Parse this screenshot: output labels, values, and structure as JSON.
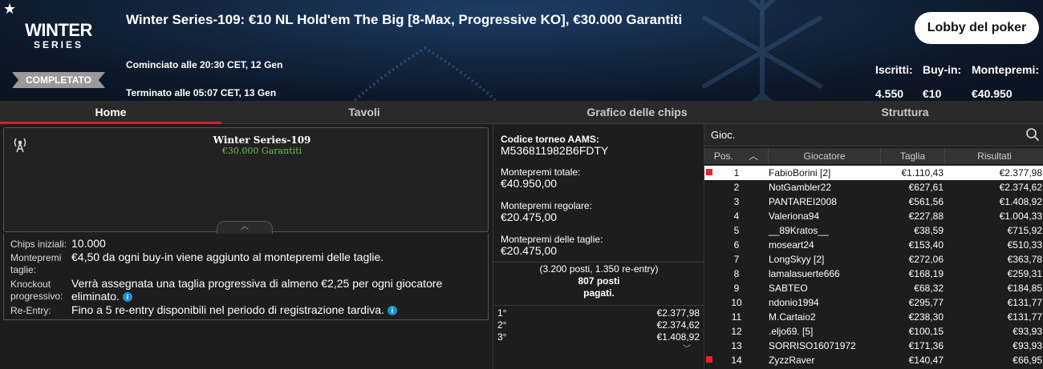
{
  "header": {
    "logo_line1": "WINTER",
    "logo_line2": "SERIES",
    "status_badge": "COMPLETATO",
    "title": "Winter Series-109: €10 NL Hold'em The Big [8-Max, Progressive KO], €30.000 Garantiti",
    "started": "Cominciato alle 20:30 CET, 12 Gen",
    "ended": "Terminato alle 05:07 CET, 13 Gen",
    "lobby_button": "Lobby del poker",
    "stats": [
      {
        "label": "Iscritti:",
        "value": "4.550"
      },
      {
        "label": "Buy-in:",
        "value": "€10"
      },
      {
        "label": "Montepremi:",
        "value": "€40.950"
      }
    ]
  },
  "tabs": [
    {
      "label": "Home",
      "active": true
    },
    {
      "label": "Tavoli",
      "active": false
    },
    {
      "label": "Grafico delle chips",
      "active": false
    },
    {
      "label": "Struttura",
      "active": false
    }
  ],
  "tournament_box": {
    "name": "Winter Series-109",
    "guarantee": "€30.000 Garantiti",
    "guarantee_color": "#6bbf4e"
  },
  "info": {
    "chips_label": "Chips iniziali:",
    "chips_value": "10.000",
    "bounty_pool_label_1": "Montepremi",
    "bounty_pool_label_2": "taglie:",
    "bounty_pool_value": "€4,50 da ogni buy-in viene aggiunto al montepremi delle taglie.",
    "knockout_label_1": "Knockout",
    "knockout_label_2": "progressivo:",
    "knockout_value_1": "Verrà assegnata una taglia progressiva di almeno €2,25 per ogni giocatore",
    "knockout_value_2": "eliminato.",
    "reentry_label": "Re-Entry:",
    "reentry_value": "Fino a 5 re-entry disponibili nel periodo di registrazione tardiva."
  },
  "middle": {
    "aams_label": "Codice torneo AAMS:",
    "aams_code": "M536811982B6FDTY",
    "total_label": "Montepremi totale:",
    "total_value": "€40.950,00",
    "regular_label": "Montepremi regolare:",
    "regular_value": "€20.475,00",
    "bounty_label": "Montepremi delle taglie:",
    "bounty_value": "€20.475,00",
    "seats_line1": "(3.200 posti, 1.350 re-entry)",
    "seats_line2": "807 posti",
    "seats_line3": "pagati.",
    "prizes": [
      {
        "place": "1°",
        "amount": "€2.377,98"
      },
      {
        "place": "2°",
        "amount": "€2.374,62"
      },
      {
        "place": "3°",
        "amount": "€1.408,92"
      }
    ]
  },
  "players": {
    "search_label": "Gioc.",
    "columns": [
      "Pos.",
      "Giocatore",
      "Taglia",
      "Risultati"
    ],
    "rows": [
      {
        "pos": "1",
        "name": "FabioBorini [2]",
        "stack": "€1.110,43",
        "result": "€2.377,98",
        "highlight": true,
        "mark": true
      },
      {
        "pos": "2",
        "name": "NotGambler22",
        "stack": "€627,61",
        "result": "€2.374,62"
      },
      {
        "pos": "3",
        "name": "PANTAREI2008",
        "stack": "€561,56",
        "result": "€1.408,92"
      },
      {
        "pos": "4",
        "name": "Valeriona94",
        "stack": "€227,88",
        "result": "€1.004,33"
      },
      {
        "pos": "5",
        "name": "__89Kratos__",
        "stack": "€38,59",
        "result": "€715,92"
      },
      {
        "pos": "6",
        "name": "moseart24",
        "stack": "€153,40",
        "result": "€510,33"
      },
      {
        "pos": "7",
        "name": "LongSkyy [2]",
        "stack": "€272,06",
        "result": "€363,78"
      },
      {
        "pos": "8",
        "name": "lamalasuerte666",
        "stack": "€168,19",
        "result": "€259,31"
      },
      {
        "pos": "9",
        "name": "SABTEO",
        "stack": "€68,32",
        "result": "€184,85"
      },
      {
        "pos": "10",
        "name": "ndonio1994",
        "stack": "€295,77",
        "result": "€131,77"
      },
      {
        "pos": "11",
        "name": "M.Cartaio2",
        "stack": "€238,30",
        "result": "€131,77"
      },
      {
        "pos": "12",
        "name": ".eljo69. [5]",
        "stack": "€100,15",
        "result": "€93,93"
      },
      {
        "pos": "13",
        "name": "SORRISO16071972",
        "stack": "€171,36",
        "result": "€93,93"
      },
      {
        "pos": "14",
        "name": "ZyzzRaver",
        "stack": "€140,47",
        "result": "€66,95",
        "mark": true
      }
    ]
  }
}
